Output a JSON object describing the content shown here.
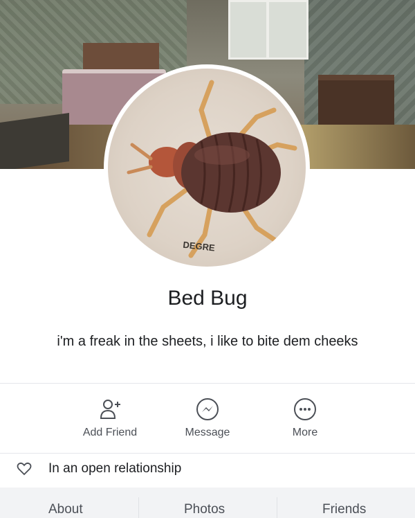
{
  "profile": {
    "name": "Bed Bug",
    "bio": "i'm a freak in the sheets, i like to bite dem cheeks"
  },
  "actions": [
    {
      "label": "Add Friend",
      "icon": "add-friend-icon"
    },
    {
      "label": "Message",
      "icon": "messenger-icon"
    },
    {
      "label": "More",
      "icon": "more-icon"
    }
  ],
  "relationship": {
    "icon": "heart-icon",
    "text": "In an open relationship"
  },
  "tabs": [
    {
      "label": "About"
    },
    {
      "label": "Photos"
    },
    {
      "label": "Friends"
    }
  ],
  "colors": {
    "text": "#1c1e21",
    "secondary_text": "#4b4f56",
    "divider": "#e4e6eb",
    "tab_bar": "#f2f3f5"
  }
}
